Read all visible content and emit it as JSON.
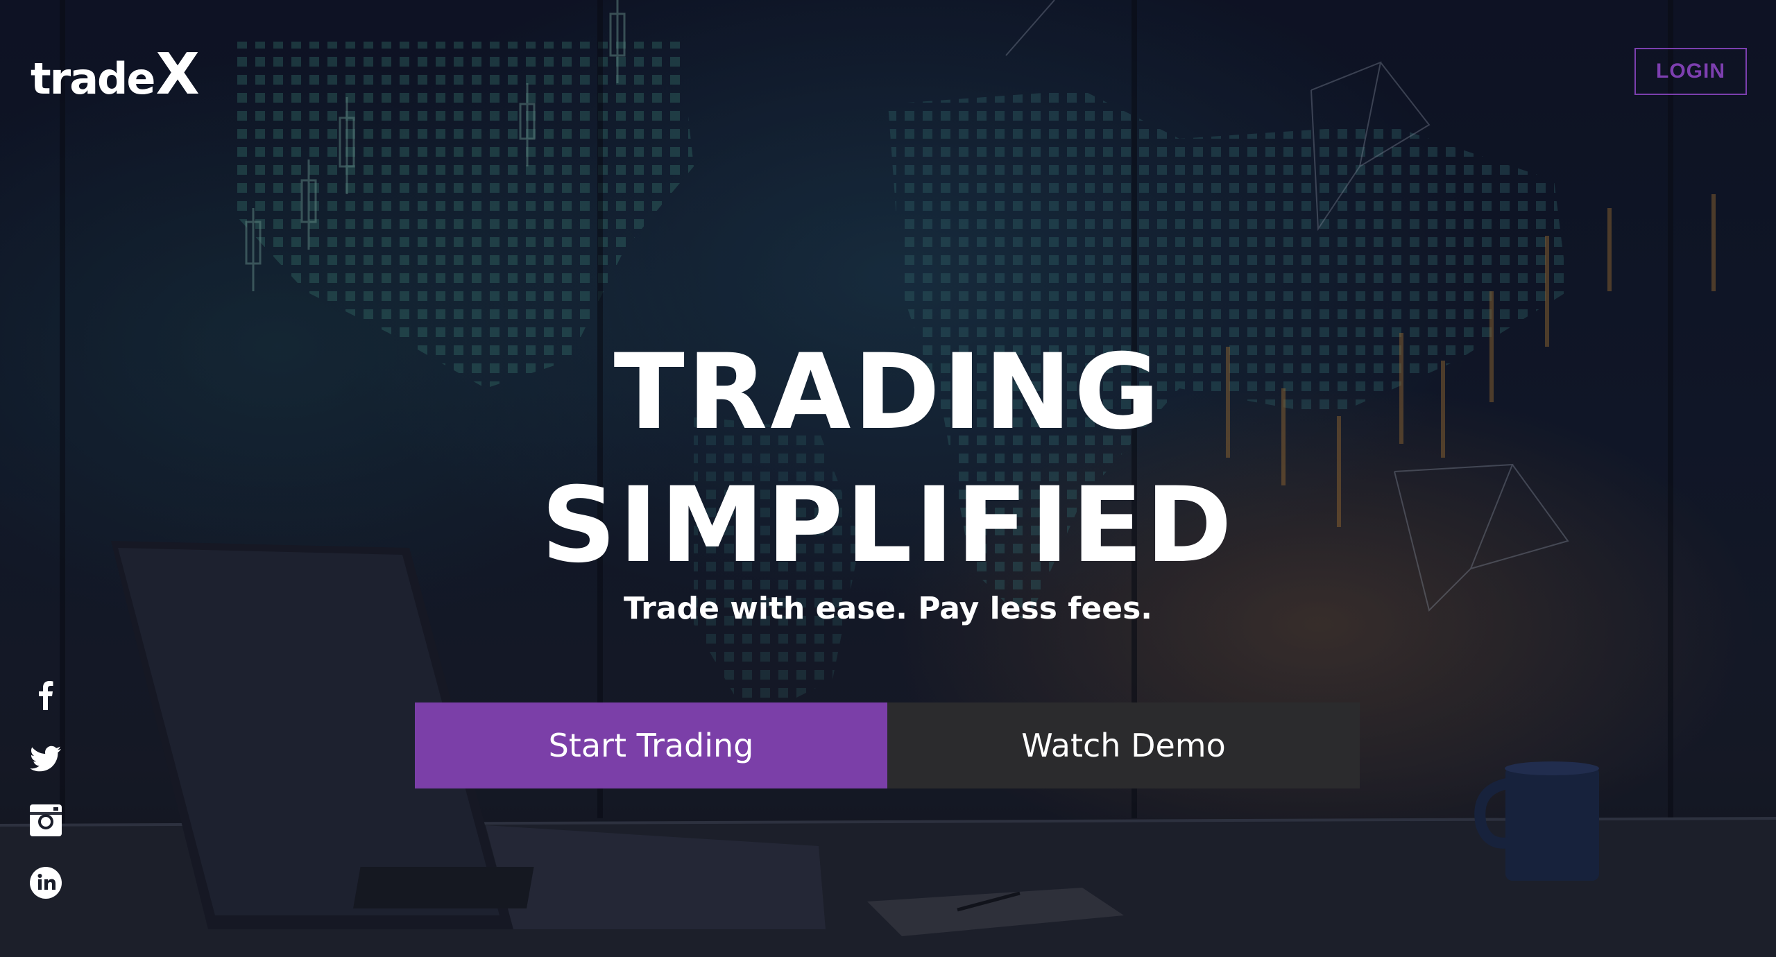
{
  "brand": {
    "logo_main": "trade",
    "logo_x": "X"
  },
  "header": {
    "login_label": "LOGIN"
  },
  "hero": {
    "headline_line1": "TRADING",
    "headline_line2": "SIMPLIFIED",
    "subheadline": "Trade with ease. Pay less fees.",
    "primary_cta": "Start Trading",
    "secondary_cta": "Watch Demo"
  },
  "social": [
    "facebook-icon",
    "twitter-icon",
    "instagram-icon",
    "linkedin-icon"
  ],
  "colors": {
    "accent": "#7b3fa8",
    "secondary_button": "#2b2b2d",
    "text": "#ffffff"
  }
}
